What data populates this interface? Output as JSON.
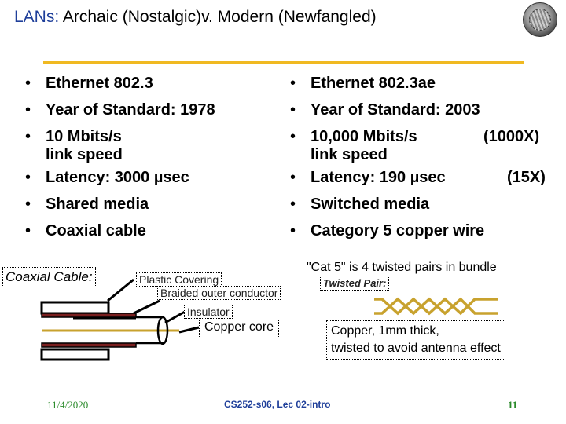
{
  "slide": {
    "title_accent": "LANs:",
    "title_rest": " Archaic (Nostalgic)v. Modern (Newfangled)",
    "logo_icon": "university-seal-icon",
    "colors": {
      "accent": "#1f3f9a",
      "rule": "#f0b921",
      "footer_green": "#2a8a2a",
      "copper": "#c8a22e",
      "braid": "#7a1f1f"
    }
  },
  "left_column": {
    "items": [
      {
        "text": "Ethernet 802.3"
      },
      {
        "text": "Year of Standard: 1978"
      },
      {
        "text": "10 Mbits/s",
        "continuation": "link speed"
      },
      {
        "text": "Latency: 3000 µsec"
      },
      {
        "text": "Shared media"
      },
      {
        "text": "Coaxial cable"
      }
    ]
  },
  "right_column": {
    "items": [
      {
        "text": "Ethernet 802.3ae"
      },
      {
        "text": "Year of Standard: 2003"
      },
      {
        "text": "10,000 Mbits/s",
        "ratio": "(1000X)",
        "continuation": "link speed"
      },
      {
        "text": "Latency: 190 µsec",
        "ratio": "(15X)"
      },
      {
        "text": "Switched media"
      },
      {
        "text": "Category 5 copper wire"
      }
    ]
  },
  "coax_diagram": {
    "label": "Coaxial Cable:",
    "parts": {
      "plastic": "Plastic Covering",
      "braided": "Braided outer conductor",
      "insulator": "Insulator",
      "core": "Copper core"
    }
  },
  "twisted_pair": {
    "note": "\"Cat 5\" is 4 twisted pairs in bundle",
    "label": "Twisted Pair:",
    "desc_line1": "Copper, 1mm thick,",
    "desc_line2": "twisted to avoid antenna effect"
  },
  "footer": {
    "date": "11/4/2020",
    "course": "CS252-s06, Lec 02-intro",
    "page": "11"
  }
}
